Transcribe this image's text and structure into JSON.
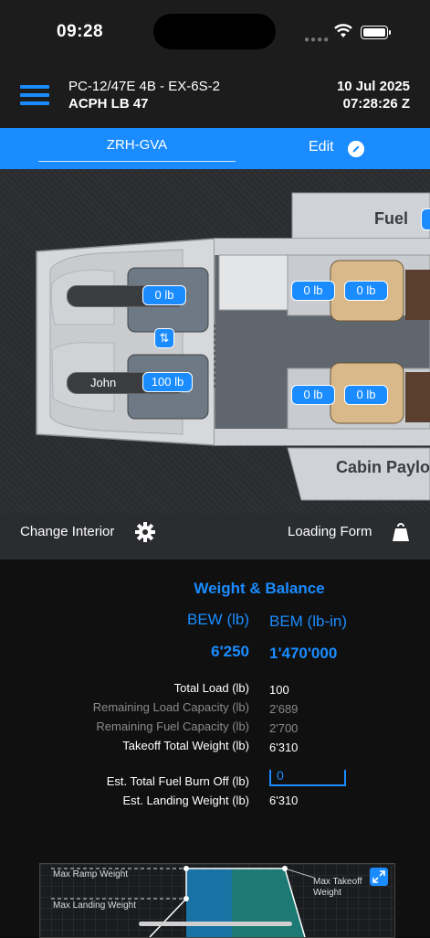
{
  "status_bar": {
    "time": "09:28"
  },
  "header": {
    "aircraft_type": "PC-12/47E 4B - EX-6S-2",
    "aircraft_reg": "ACPH LB 47",
    "date": "10 Jul 2025",
    "time": "07:28:26 Z"
  },
  "tabs": {
    "route": "ZRH-GVA",
    "edit": "Edit"
  },
  "aircraft": {
    "fuel_label": "Fuel",
    "cabin_label": "Cabin Paylo",
    "cockpit_seats": [
      {
        "name": "",
        "weight": "0 lb"
      },
      {
        "name": "John",
        "weight": "100 lb"
      }
    ],
    "cabin_seats": [
      "0 lb",
      "0 lb",
      "0 lb",
      "0 lb"
    ]
  },
  "actions": {
    "change_interior": "Change Interior",
    "loading_form": "Loading Form"
  },
  "weight_balance": {
    "title": "Weight & Balance",
    "bew_label": "BEW (lb)",
    "bem_label": "BEM (lb-in)",
    "bew_value": "6'250",
    "bem_value": "1'470'000",
    "rows": [
      {
        "label": "Total Load (lb)",
        "value": "100",
        "muted": false
      },
      {
        "label": "Remaining Load Capacity (lb)",
        "value": "2'689",
        "muted": true
      },
      {
        "label": "Remaining Fuel Capacity (lb)",
        "value": "2'700",
        "muted": true
      },
      {
        "label": "Takeoff Total Weight (lb)",
        "value": "6'310",
        "muted": false
      }
    ],
    "fuel_burn_label": "Est. Total Fuel Burn Off (lb)",
    "fuel_burn_value": "0",
    "landing_label": "Est. Landing Weight (lb)",
    "landing_value": "6'310"
  },
  "envelope_chart": {
    "max_ramp": "Max Ramp Weight",
    "max_landing": "Max Landing Weight",
    "max_takeoff_1": "Max Takeoff",
    "max_takeoff_2": "Weight"
  },
  "colors": {
    "accent": "#1a8cff",
    "teal": "#2bb5a8"
  }
}
